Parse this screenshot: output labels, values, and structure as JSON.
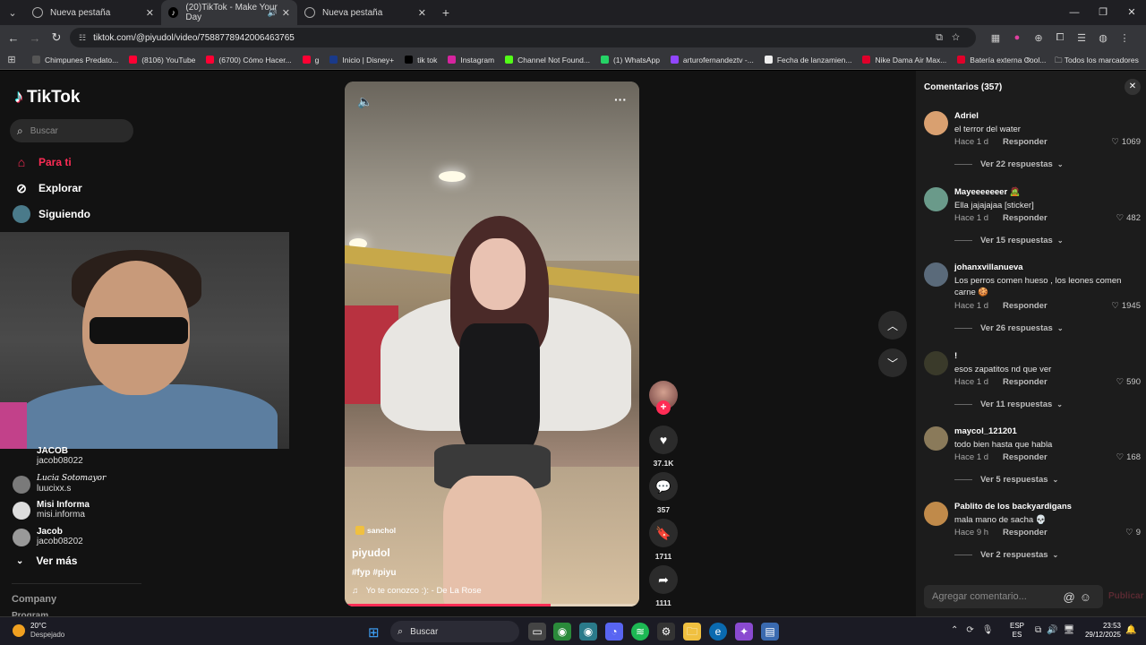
{
  "browser": {
    "tabs": [
      {
        "label": "Nueva pestaña",
        "active": false
      },
      {
        "label": "(20)TikTok - Make Your Day",
        "active": true
      },
      {
        "label": "Nueva pestaña",
        "active": false
      }
    ],
    "url": "tiktok.com/@piyudol/video/7588778942006463765",
    "bookmarks": [
      {
        "label": "Chimpunes Predato...",
        "color": "#555555"
      },
      {
        "label": "(8106) YouTube",
        "color": "#ff0033"
      },
      {
        "label": "(6700) Cómo Hacer...",
        "color": "#ff0033"
      },
      {
        "label": "g",
        "color": "#ff0033"
      },
      {
        "label": "Inicio | Disney+",
        "color": "#1a3a8a"
      },
      {
        "label": "tik tok",
        "color": "#000000"
      },
      {
        "label": "Instagram",
        "color": "#d6249f"
      },
      {
        "label": "Channel Not Found...",
        "color": "#53fc18"
      },
      {
        "label": "(1) WhatsApp",
        "color": "#25d366"
      },
      {
        "label": "arturofernandeztv -...",
        "color": "#9146ff"
      },
      {
        "label": "Fecha de lanzamien...",
        "color": "#eeeeee"
      },
      {
        "label": "Nike Dama Air Max...",
        "color": "#e0002a"
      },
      {
        "label": "Batería externa Cool...",
        "color": "#e0002a"
      }
    ],
    "bookmarks_more": "»",
    "all_bookmarks": "Todos los marcadores"
  },
  "sidebar": {
    "logo": "TikTok",
    "search_placeholder": "Buscar",
    "nav": [
      {
        "label": "Para ti",
        "icon": "home-icon",
        "active": true
      },
      {
        "label": "Explorar",
        "icon": "compass-icon",
        "active": false
      },
      {
        "label": "Siguiendo",
        "icon": "following-icon",
        "active": false
      }
    ],
    "accounts": [
      {
        "name": "JACOB",
        "handle": "jacob08022"
      },
      {
        "name": "Lucia Sotomayor",
        "handle": "luucixx.s"
      },
      {
        "name": "Misi Informa",
        "handle": "misi.informa"
      },
      {
        "name": "Jacob",
        "handle": "jacob08202"
      }
    ],
    "see_more": "Ver más",
    "company": "Company",
    "program": "Program"
  },
  "video": {
    "tag": "sanchol",
    "author": "piyudol",
    "hashtags": "#fyp #piyu",
    "music": "Yo te conozco :): - De La Rose",
    "progress": 0.7,
    "actions": {
      "likes": "37.1K",
      "comments": "357",
      "saves": "1711",
      "shares": "1111"
    }
  },
  "comments": {
    "header": "Comentarios (357)",
    "items": [
      {
        "user": "Adriel",
        "text": "el terror del water",
        "time": "Hace 1 d",
        "reply": "Responder",
        "likes": "1069",
        "replies": "Ver 22 respuestas",
        "avatar": "#d9a070"
      },
      {
        "user": "Mayeeeeeeer 🧟",
        "text": "Ella jajajajaa [sticker]",
        "time": "Hace 1 d",
        "reply": "Responder",
        "likes": "482",
        "replies": "Ver 15 respuestas",
        "avatar": "#6a9a8a"
      },
      {
        "user": "johanxvillanueva",
        "text": "Los perros comen hueso , los leones comen carne 🍪",
        "time": "Hace 1 d",
        "reply": "Responder",
        "likes": "1945",
        "replies": "Ver 26 respuestas",
        "avatar": "#5a6a7a"
      },
      {
        "user": "!",
        "text": "esos zapatitos nd que ver",
        "time": "Hace 1 d",
        "reply": "Responder",
        "likes": "590",
        "replies": "Ver 11 respuestas",
        "avatar": "#3a3a2a"
      },
      {
        "user": "maycol_121201",
        "text": "todo bien hasta que habla",
        "time": "Hace 1 d",
        "reply": "Responder",
        "likes": "168",
        "replies": "Ver 5 respuestas",
        "avatar": "#8a7a5a"
      },
      {
        "user": "Pablito de los backyardigans",
        "text": "mala mano de sacha 💀",
        "time": "Hace 9 h",
        "reply": "Responder",
        "likes": "9",
        "replies": "Ver 2 respuestas",
        "avatar": "#c08a4a"
      }
    ],
    "input_placeholder": "Agregar comentario...",
    "post_label": "Publicar"
  },
  "taskbar": {
    "weather_temp": "20°C",
    "weather_desc": "Despejado",
    "search_label": "Buscar",
    "lang_top": "ESP",
    "lang_bottom": "ES",
    "time": "23:53",
    "date": "29/12/2025"
  }
}
